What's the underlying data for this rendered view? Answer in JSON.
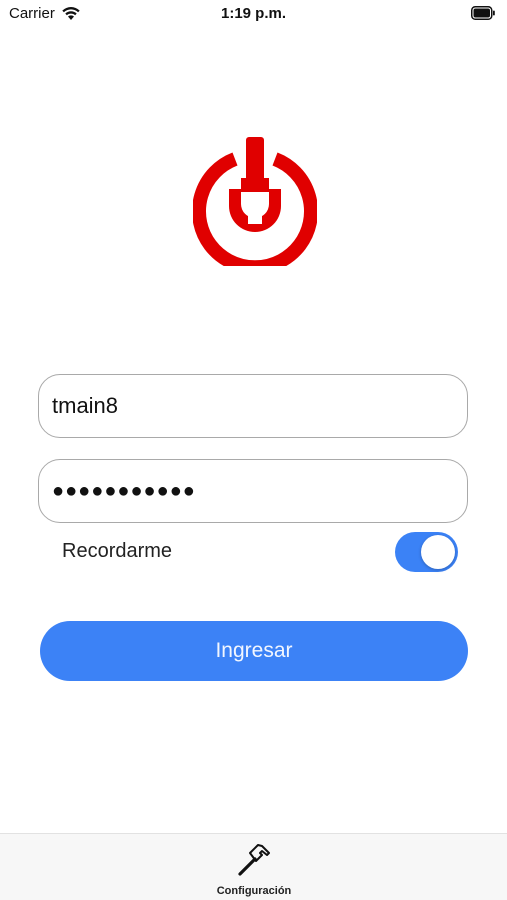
{
  "status_bar": {
    "carrier": "Carrier",
    "time": "1:19 p.m.",
    "wifi_icon": "wifi-icon",
    "battery_icon": "battery-icon"
  },
  "logo": {
    "icon": "power-wrench-icon",
    "color": "#e00000"
  },
  "login_form": {
    "username_value": "tmain8",
    "password_value": "●●●●●●●●●●●",
    "remember_label": "Recordarme",
    "remember_enabled": true,
    "submit_label": "Ingresar"
  },
  "tab_bar": {
    "items": [
      {
        "label": "Configuración",
        "icon": "hammer-icon"
      }
    ]
  },
  "colors": {
    "accent": "#3c82f6",
    "logo_red": "#e00000",
    "tab_bar_bg": "#f7f7f7"
  }
}
